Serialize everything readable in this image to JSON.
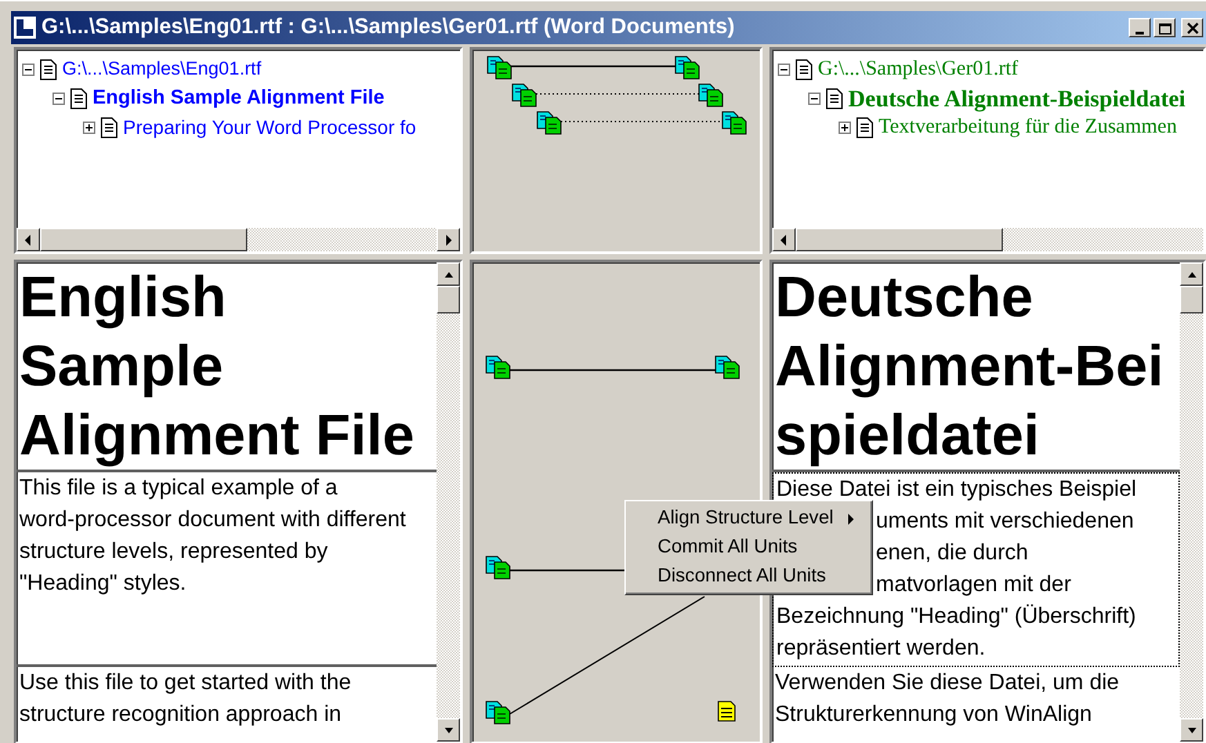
{
  "window": {
    "title": "G:\\...\\Samples\\Eng01.rtf : G:\\...\\Samples\\Ger01.rtf (Word Documents)",
    "active": true
  },
  "source_tree": [
    {
      "label": "G:\\...\\Samples\\Eng01.rtf",
      "expanded": true,
      "children": [
        {
          "label": "English Sample Alignment File",
          "expanded": true,
          "children": [
            {
              "label": "Preparing Your Word Processor fo",
              "expanded": false
            }
          ]
        }
      ]
    }
  ],
  "structure_links": [
    {
      "committed": true
    },
    {
      "committed": false
    },
    {
      "committed": false
    }
  ],
  "target_tree": [
    {
      "label": "G:\\...\\Samples\\Ger01.rtf",
      "expanded": true,
      "children": [
        {
          "label": "Deutsche Alignment-Beispieldatei",
          "expanded": true,
          "children": [
            {
              "label": "Textverarbeitung für die Zusammen",
              "expanded": false
            }
          ]
        }
      ]
    }
  ],
  "source_document": [
    {
      "kind": "heading",
      "selected": false,
      "lines": [
        "English",
        "Sample",
        "Alignment File"
      ]
    },
    {
      "kind": "body",
      "selected": false,
      "lines": [
        "This file is a typical example of a",
        "word-processor document with different",
        "structure levels, represented by",
        "\"Heading\" styles."
      ]
    },
    {
      "kind": "body",
      "selected": false,
      "lines": [
        "Use this file to get started with the",
        "structure recognition approach in"
      ]
    }
  ],
  "alignment_links": [
    {
      "kind": "aligned_pair"
    },
    {
      "kind": "source_link"
    },
    {
      "kind": "diagonal_link"
    },
    {
      "kind": "unaligned_target"
    }
  ],
  "target_document": [
    {
      "kind": "heading",
      "selected": false,
      "lines": [
        "Deutsche",
        "Alignment-Bei",
        "spieldatei"
      ]
    },
    {
      "kind": "body",
      "selected": true,
      "lines": [
        "Diese Datei ist ein typisches Beispiel",
        "uments mit verschiedenen",
        "enen, die durch",
        "matvorlagen mit der",
        "Bezeichnung \"Heading\" (Überschrift)",
        "repräsentiert werden."
      ]
    },
    {
      "kind": "body",
      "selected": false,
      "lines": [
        "Verwenden Sie diese Datei, um die",
        "Strukturerkennung von WinAlign"
      ]
    }
  ],
  "context_menu": [
    {
      "label": "Align Structure Level",
      "has_submenu": true
    },
    {
      "label": "Commit All Units",
      "has_submenu": false
    },
    {
      "label": "Disconnect All Units",
      "has_submenu": false
    }
  ]
}
